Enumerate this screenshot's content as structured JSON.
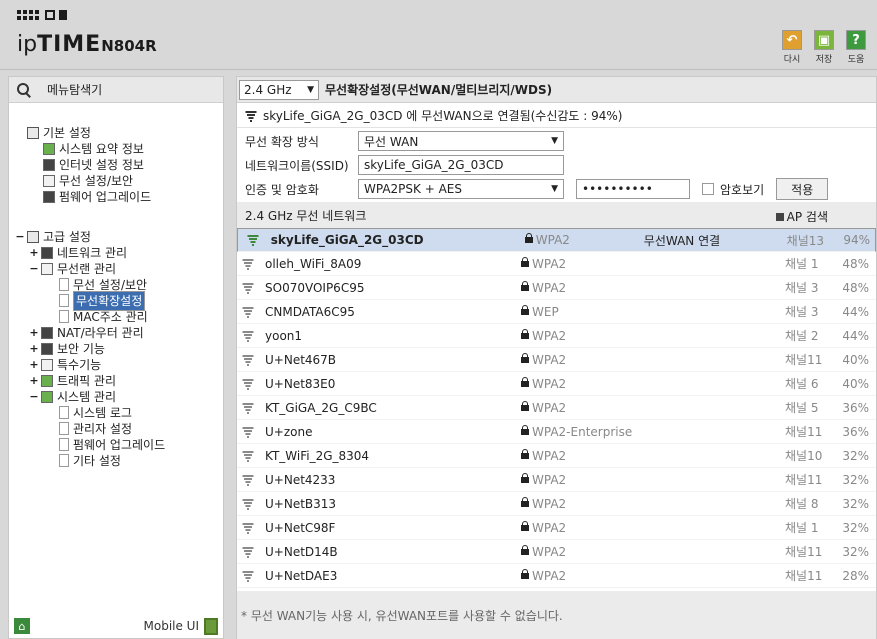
{
  "header": {
    "logo_prefix": "ip",
    "logo_brand": "TIME",
    "logo_model": "N804R",
    "tools": [
      {
        "label": "다시",
        "icon": "undo-icon",
        "color": "#e0a030",
        "glyph": "↶"
      },
      {
        "label": "저장",
        "icon": "save-icon",
        "color": "#7bb53c",
        "glyph": "▣"
      },
      {
        "label": "도움",
        "icon": "help-icon",
        "color": "#3e9a3e",
        "glyph": "?"
      }
    ]
  },
  "sidebar": {
    "title": "메뉴탐색기",
    "basic": {
      "label": "기본 설정",
      "items": [
        "시스템 요약 정보",
        "인터넷 설정 정보",
        "무선 설정/보안",
        "펌웨어 업그레이드"
      ]
    },
    "advanced": {
      "toggle": "−",
      "label": "고급 설정",
      "network": {
        "toggle": "+",
        "label": "네트워크 관리"
      },
      "wireless": {
        "toggle": "−",
        "label": "무선랜 관리",
        "items": [
          "무선 설정/보안",
          "무선확장설정",
          "MAC주소 관리"
        ]
      },
      "nat": {
        "toggle": "+",
        "label": "NAT/라우터 관리"
      },
      "security": {
        "toggle": "+",
        "label": "보안 기능"
      },
      "special": {
        "toggle": "+",
        "label": "특수기능"
      },
      "traffic": {
        "toggle": "+",
        "label": "트래픽 관리"
      },
      "system": {
        "toggle": "−",
        "label": "시스템 관리",
        "items": [
          "시스템 로그",
          "관리자 설정",
          "펌웨어 업그레이드",
          "기타 설정"
        ]
      }
    },
    "footer": {
      "home_glyph": "⌂",
      "mobile_label": "Mobile UI"
    }
  },
  "main": {
    "band": "2.4 GHz",
    "title": "무선확장설정(무선WAN/멀티브리지/WDS)",
    "status": "skyLife_GiGA_2G_03CD 에 무선WAN으로 연결됨(수신감도 : 94%)",
    "form": {
      "mode_label": "무선 확장 방식",
      "mode_value": "무선 WAN",
      "ssid_label": "네트워크이름(SSID)",
      "ssid_value": "skyLife_GiGA_2G_03CD",
      "auth_label": "인증 및 암호화",
      "auth_value": "WPA2PSK + AES",
      "password_value": "••••••••••",
      "show_password_label": "암호보기",
      "apply_label": "적용"
    },
    "list_title": "2.4 GHz 무선 네트워크",
    "ap_search_label": "AP 검색",
    "networks": [
      {
        "ssid": "skyLife_GiGA_2G_03CD",
        "security": "WPA2",
        "note": "무선WAN 연결",
        "channel": "채널13",
        "signal": "94%"
      },
      {
        "ssid": "olleh_WiFi_8A09",
        "security": "WPA2",
        "note": "",
        "channel": "채널 1",
        "signal": "48%"
      },
      {
        "ssid": "SO070VOIP6C95",
        "security": "WPA2",
        "note": "",
        "channel": "채널 3",
        "signal": "48%"
      },
      {
        "ssid": "CNMDATA6C95",
        "security": "WEP",
        "note": "",
        "channel": "채널 3",
        "signal": "44%"
      },
      {
        "ssid": "yoon1",
        "security": "WPA2",
        "note": "",
        "channel": "채널 2",
        "signal": "44%"
      },
      {
        "ssid": "U+Net467B",
        "security": "WPA2",
        "note": "",
        "channel": "채널11",
        "signal": "40%"
      },
      {
        "ssid": "U+Net83E0",
        "security": "WPA2",
        "note": "",
        "channel": "채널 6",
        "signal": "40%"
      },
      {
        "ssid": "KT_GiGA_2G_C9BC",
        "security": "WPA2",
        "note": "",
        "channel": "채널 5",
        "signal": "36%"
      },
      {
        "ssid": "U+zone",
        "security": "WPA2-Enterprise",
        "note": "",
        "channel": "채널11",
        "signal": "36%"
      },
      {
        "ssid": "KT_WiFi_2G_8304",
        "security": "WPA2",
        "note": "",
        "channel": "채널10",
        "signal": "32%"
      },
      {
        "ssid": "U+Net4233",
        "security": "WPA2",
        "note": "",
        "channel": "채널11",
        "signal": "32%"
      },
      {
        "ssid": "U+NetB313",
        "security": "WPA2",
        "note": "",
        "channel": "채널 8",
        "signal": "32%"
      },
      {
        "ssid": "U+NetC98F",
        "security": "WPA2",
        "note": "",
        "channel": "채널 1",
        "signal": "32%"
      },
      {
        "ssid": "U+NetD14B",
        "security": "WPA2",
        "note": "",
        "channel": "채널11",
        "signal": "32%"
      },
      {
        "ssid": "U+NetDAE3",
        "security": "WPA2",
        "note": "",
        "channel": "채널11",
        "signal": "28%"
      }
    ],
    "footnote": "* 무선 WAN기능 사용 시, 유선WAN포트를 사용할 수 없습니다."
  }
}
